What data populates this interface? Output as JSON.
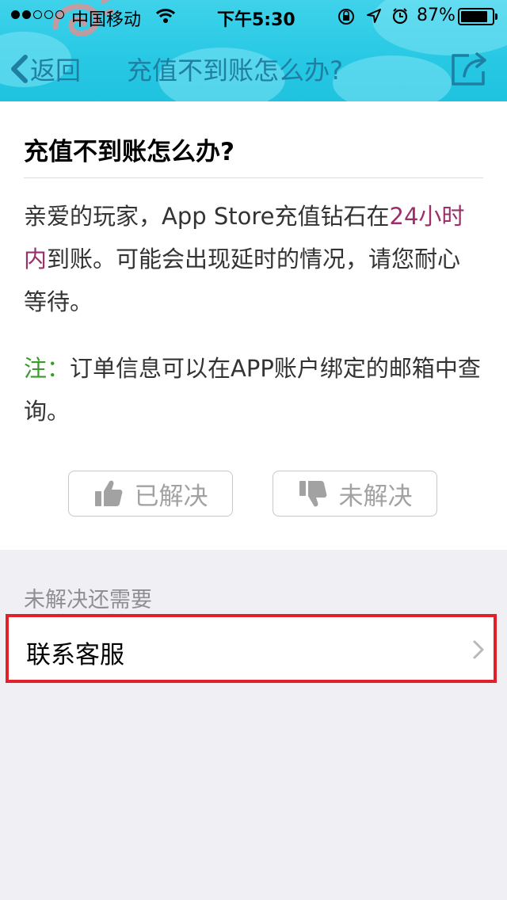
{
  "status_bar": {
    "carrier": "中国移动",
    "time": "下午5:30",
    "battery_percent": "87%",
    "battery_level": 0.87,
    "signal_dots_filled": 2,
    "signal_dots_total": 5,
    "icons": [
      "signal-dots-icon",
      "wifi-icon",
      "rotation-lock-icon",
      "location-icon",
      "alarm-icon",
      "battery-icon"
    ]
  },
  "nav": {
    "back_label": "返回",
    "title": "充值不到账怎么办?",
    "share_icon": "share-icon"
  },
  "article": {
    "title": "充值不到账怎么办?",
    "answer_prefix": "亲爱的玩家，App Store充值钻石在",
    "answer_highlight": "24小时内",
    "answer_suffix": "到账。可能会出现延时的情况，请您耐心等待。",
    "note_label": "注：",
    "note_text": "订单信息可以在APP账户绑定的邮箱中查询。",
    "highlight_color": "#9b2f69",
    "note_color": "#3a9a2c"
  },
  "feedback": {
    "resolved_label": "已解决",
    "unresolved_label": "未解决"
  },
  "support": {
    "section_label": "未解决还需要",
    "contact_label": "联系客服"
  },
  "colors": {
    "header_bg": "#27c8e4",
    "nav_text": "#1f7fa2",
    "highlight_box": "#e3202a"
  }
}
